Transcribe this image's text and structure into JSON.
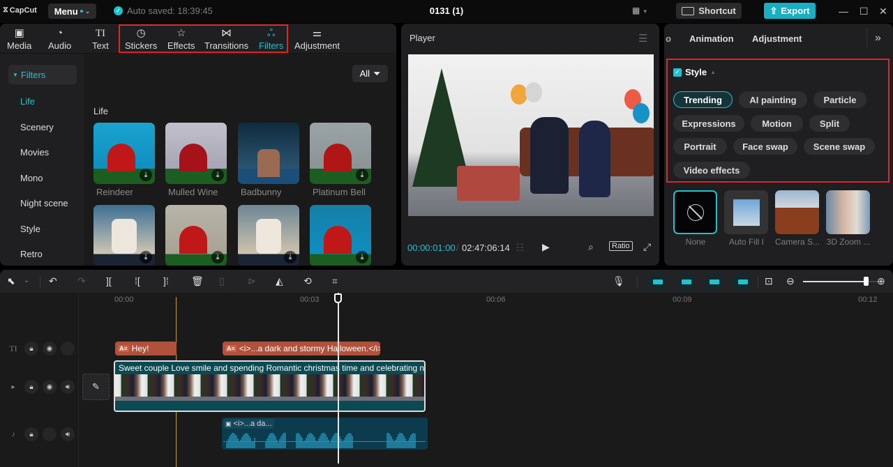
{
  "titlebar": {
    "logo": "CapCut",
    "menu_label": "Menu",
    "autosave": "Auto saved: 18:39:45",
    "project_title": "0131 (1)",
    "shortcut_label": "Shortcut",
    "export_label": "Export",
    "window_controls": [
      "minimize",
      "maximize",
      "close"
    ]
  },
  "media_tabs": [
    {
      "label": "Media",
      "icon": "media-icon"
    },
    {
      "label": "Audio",
      "icon": "audio-icon"
    },
    {
      "label": "Text",
      "icon": "text-icon"
    },
    {
      "label": "Stickers",
      "icon": "sticker-icon"
    },
    {
      "label": "Effects",
      "icon": "effects-icon"
    },
    {
      "label": "Transitions",
      "icon": "transitions-icon"
    },
    {
      "label": "Filters",
      "icon": "filters-icon",
      "active": true
    },
    {
      "label": "Adjustment",
      "icon": "adjustment-icon"
    }
  ],
  "filters_sidebar": {
    "header": "Filters",
    "items": [
      "Life",
      "Scenery",
      "Movies",
      "Mono",
      "Night scene",
      "Style",
      "Retro"
    ],
    "active": "Life"
  },
  "filters_content": {
    "filter_button": "All",
    "section": "Life",
    "items": [
      {
        "label": "Reindeer"
      },
      {
        "label": "Mulled Wine"
      },
      {
        "label": "Badbunny"
      },
      {
        "label": "Platinum Bell"
      },
      {
        "label": ""
      },
      {
        "label": ""
      },
      {
        "label": ""
      },
      {
        "label": ""
      }
    ]
  },
  "player": {
    "title": "Player",
    "current_time": "00:00:01:00",
    "separator": "/",
    "total_time": "02:47:06:14",
    "ratio_label": "Ratio"
  },
  "right_panel": {
    "tabs": [
      "o",
      "Animation",
      "Adjustment"
    ],
    "style_label": "Style",
    "chips": [
      "Trending",
      "AI painting",
      "Particle",
      "Expressions",
      "Motion",
      "Split",
      "Portrait",
      "Face swap",
      "Scene swap",
      "Video effects"
    ],
    "active_chip": "Trending",
    "effects": [
      {
        "label": "None"
      },
      {
        "label": "Auto Fill I"
      },
      {
        "label": "Camera S..."
      },
      {
        "label": "3D Zoom ..."
      }
    ]
  },
  "timeline": {
    "ruler": [
      "00:00",
      "00:03",
      "00:06",
      "00:09",
      "00:12"
    ],
    "text_clips": [
      "Hey!",
      "<i>...a dark and stormy Halloween.</i>"
    ],
    "video_clip_label": "Sweet couple Love smile and spending Romantic christmas time and celebrating n",
    "audio_clip_label": "<i>...a da...",
    "zoom_level": 0.83
  },
  "colors": {
    "accent": "#1fc3cf",
    "highlight_box": "#e0242d",
    "text_clip": "#b0513c",
    "video_clip": "#0b4a52",
    "audio_clip": "#0b3b4c"
  }
}
